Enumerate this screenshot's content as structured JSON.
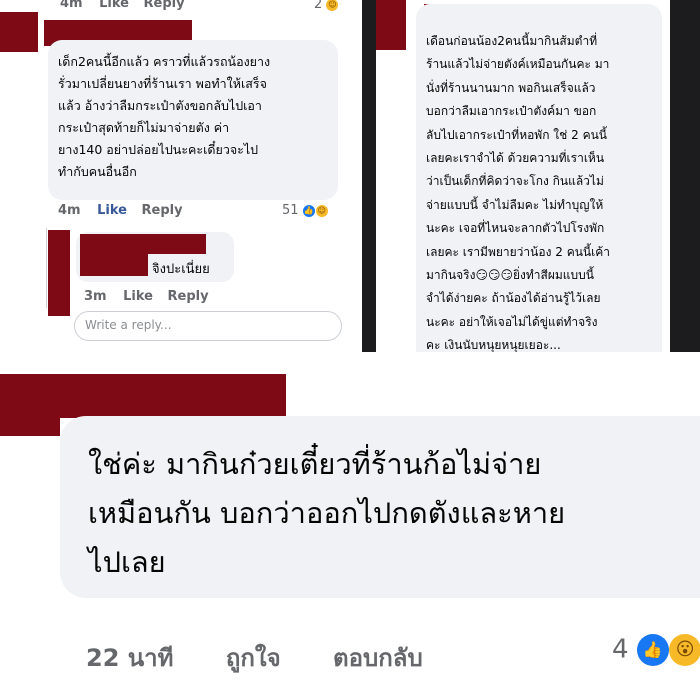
{
  "left_panel": {
    "top_meta": {
      "time": "4m",
      "like": "Like",
      "reply": "Reply",
      "count": "2"
    },
    "comment1": {
      "text": "เด็ก2คนนี้อีกแล้ว คราวที่แล้วรถน้องยาง\nรั่วมาเปลี่ยนยางที่ร้านเรา พอทำให้เสร็จ\nแล้ว อ้างว่าลืมกระเป๋าตังขอกลับไปเอา\nกระเป๋าสุดท้ายก็ไม่มาจ่ายตัง ค่า\nยาง140 อย่าปล่อยไปนะคะเดี๋ยวจะไป\nทำกับคนอื่นอีก",
      "time": "4m",
      "like": "Like",
      "reply": "Reply",
      "count": "51"
    },
    "comment2": {
      "text": "จิงปะเนี่ยย",
      "time": "3m",
      "like": "Like",
      "reply": "Reply"
    },
    "reply_input": {
      "placeholder": "Write a reply..."
    }
  },
  "right_panel": {
    "comment": {
      "text": "เดือนก่อนน้อง2คนนี้มากินส้มตำที่\nร้านแล้วไม่จ่ายตังค์เหมือนกันคะ มา\nนั่งที่ร้านนานมาก พอกินเสร็จแล้ว\nบอกว่าลืมเอากระเป๋าตังค์มา ขอก\nลับไปเอากระเป๋าที่หอพัก ใช่ 2 คนนี้\nเลยคะเราจำได้ ด้วยความที่เราเห็น\nว่าเป็นเด็กที่คิดว่าจะโกง กินแล้วไม่\nจ่ายแบบนี้ จำไม่ลืมคะ ไม่ทำบุญให้\nนะคะ เจอที่ไหนจะลากตัวไปโรงพัก\nเลยคะ เรามีพยายว่าน้อง 2 คนนี้เค้า\nมากินจริง😏😏😏ยิ่งทำสีผมแบบนี้\nจำได้ง่ายคะ ถ้าน้องได้อ่านรู้ไว้เลย\nนะคะ อย่าให้เจอไม่ได้ขู่แต่ทำจริง\nคะ เงินนับหนุยหนุยเยอะ..."
    }
  },
  "bottom_panel": {
    "comment": {
      "text": "ใช่ค่ะ มากินก๋วยเตี๋ยวที่ร้านก้อไม่จ่าย\nเหมือนกัน บอกว่าออกไปกดตังและหาย\nไปเลย",
      "time": "22 นาที",
      "like": "ถูกใจ",
      "reply": "ตอบกลับ",
      "count": "4"
    }
  },
  "colors": {
    "redaction": "#7d0a14",
    "bubble": "#f0f2f5",
    "meta": "#65676b",
    "like_blue": "#1877f2",
    "haha_yellow": "#f7b928"
  }
}
